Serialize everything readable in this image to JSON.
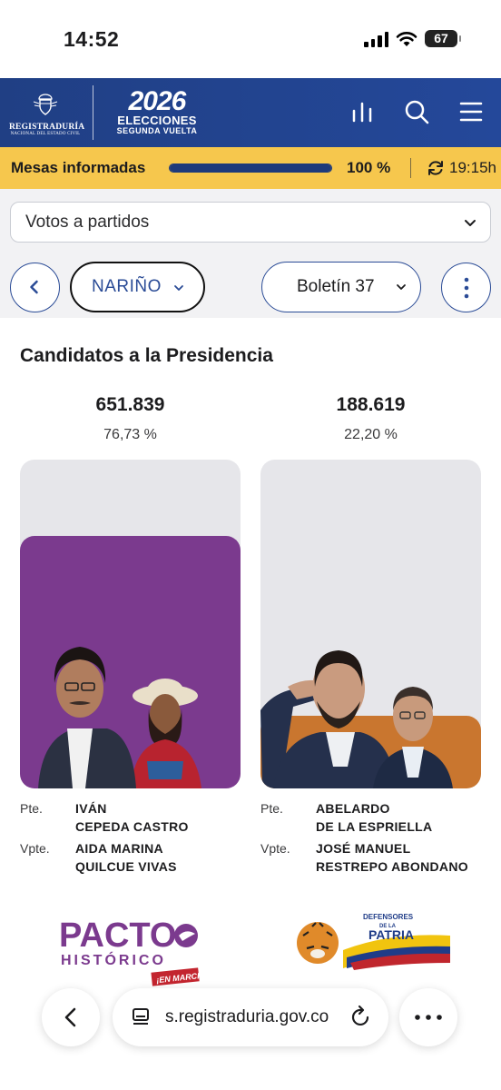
{
  "status_bar": {
    "time": "14:52",
    "battery": "67"
  },
  "header": {
    "registry_name": "REGISTRADURÍA",
    "registry_sub": "NACIONAL DEL ESTADO CIVIL",
    "event_year": "2026",
    "event_title": "ELECCIONES",
    "event_round": "SEGUNDA VUELTA",
    "icons": [
      "bar-chart-icon",
      "search-icon",
      "menu-icon"
    ]
  },
  "progress": {
    "label": "Mesas informadas",
    "value_percent": 100,
    "percent_text": "100 %",
    "updated_time": "19:15h"
  },
  "filter": {
    "selected": "Votos a partidos"
  },
  "nav": {
    "department": "NARIÑO",
    "bulletin": "Boletín 37"
  },
  "section_title": "Candidatos a la Presidencia",
  "candidates": [
    {
      "votes": "651.839",
      "percent": "76,73 %",
      "share": 76.73,
      "color": "#7b3a8e",
      "pres_role": "Pte.",
      "pres_first": "IVÁN",
      "pres_last": "CEPEDA CASTRO",
      "vp_role": "Vpte.",
      "vp_first": "AIDA MARINA",
      "vp_last": "QUILCUE VIVAS",
      "party_logo": {
        "line1": "PACTO",
        "line2": "HISTÓRICO",
        "tag": "¡EN MARCHA!"
      }
    },
    {
      "votes": "188.619",
      "percent": "22,20 %",
      "share": 22.2,
      "color": "#c9762f",
      "pres_role": "Pte.",
      "pres_first": "ABELARDO",
      "pres_last": "DE LA ESPRIELLA",
      "vp_role": "Vpte.",
      "vp_first": "JOSÉ MANUEL",
      "vp_last": "RESTREPO ABONDANO",
      "party_logo": {
        "line1": "DEFENSORES",
        "line2": "DE LA",
        "line3": "PATRIA"
      }
    }
  ],
  "browser": {
    "url": "s.registraduria.gov.co"
  }
}
